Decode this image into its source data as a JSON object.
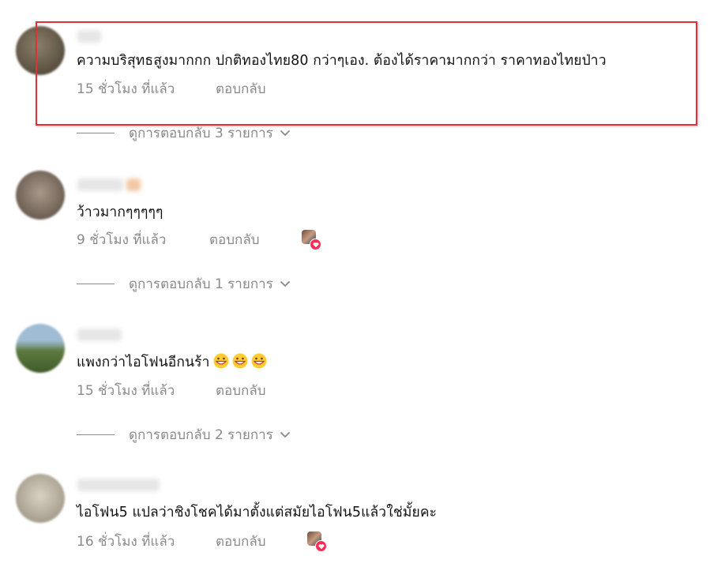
{
  "comments": [
    {
      "text": "ความบริสุทธสูงมากกก ปกติทองไทย80 กว่าๆเอง. ต้องได้ราคามากกว่า ราคาทองไทยป่าว",
      "time": "15 ชั่วโมง ที่แล้ว",
      "reply_label": "ตอบกลับ",
      "view_replies": "ดูการตอบกลับ 3 รายการ",
      "avatar_color": "#6b6150"
    },
    {
      "text": "ว้าวมากๆๆๆๆๆ",
      "time": "9 ชั่วโมง ที่แล้ว",
      "reply_label": "ตอบกลับ",
      "view_replies": "ดูการตอบกลับ 1 รายการ",
      "avatar_color": "#8c7a6e"
    },
    {
      "text": "แพงกว่าไอโฟนอีกนร้า",
      "time": "15 ชั่วโมง ที่แล้ว",
      "reply_label": "ตอบกลับ",
      "view_replies": "ดูการตอบกลับ 2 รายการ",
      "avatar_color": "#5f7a4a"
    },
    {
      "text": "ไอโฟน5 แปลว่าชิงโชคได้มาตั้งแต่สมัยไอโฟน5แล้วใช่มั้ยคะ",
      "time": "16 ชั่วโมง ที่แล้ว",
      "reply_label": "ตอบกลับ",
      "avatar_color": "#b8b0a0"
    }
  ],
  "colors": {
    "highlight": "#e0313a",
    "heart": "#fe2c55",
    "muted_text": "#8a8a8a"
  },
  "icons": {
    "chevron": "chevron-down-icon",
    "heart": "heart-icon",
    "emoji": "grinning-face-icon"
  }
}
